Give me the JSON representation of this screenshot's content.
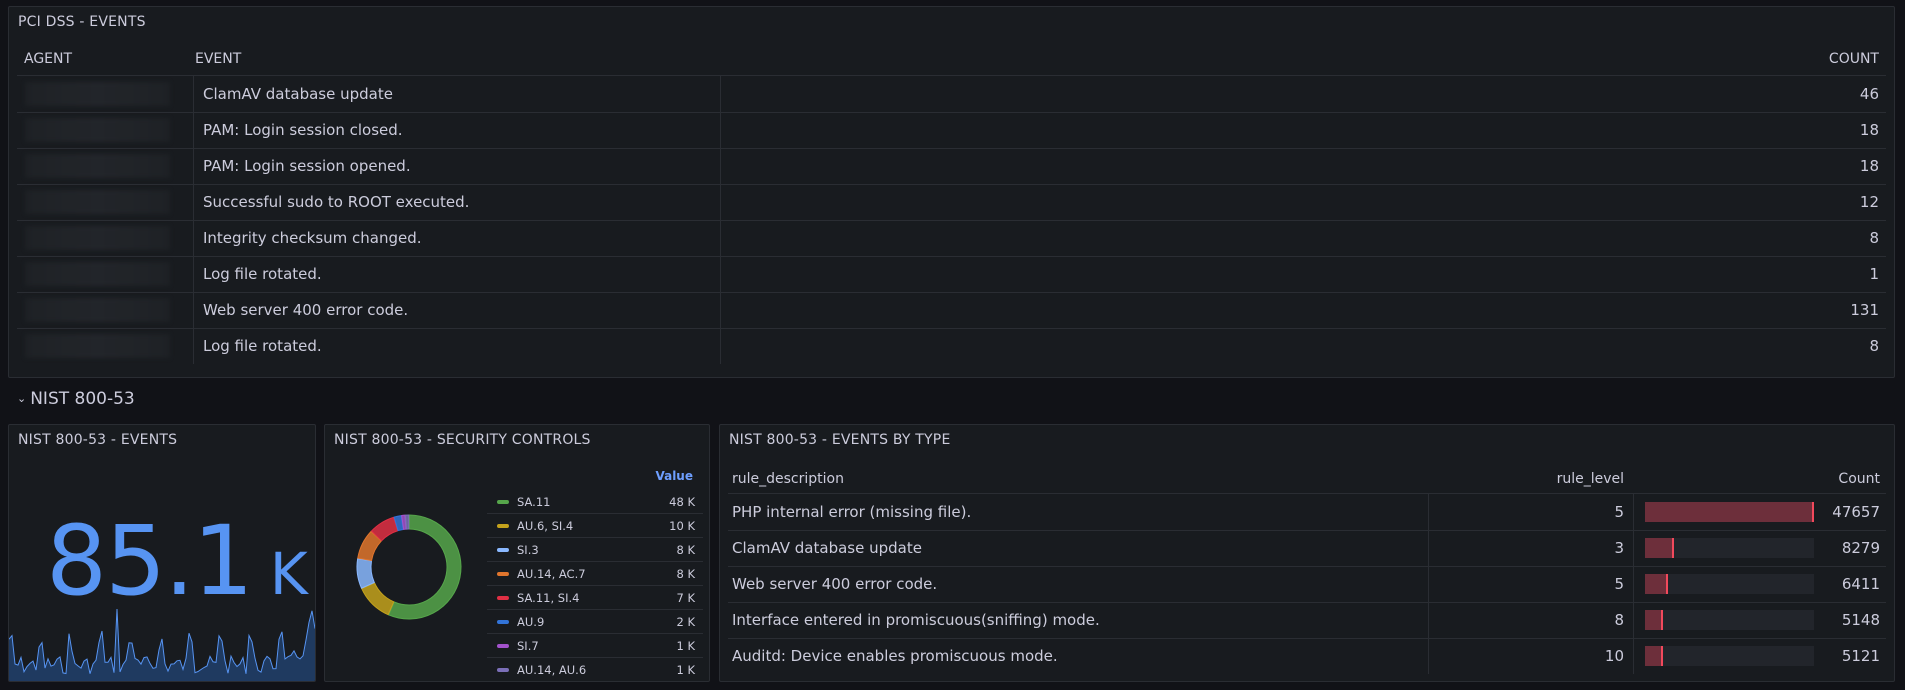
{
  "pci": {
    "title": "PCI DSS - EVENTS",
    "headers": {
      "agent": "AGENT",
      "event": "EVENT",
      "count": "COUNT"
    },
    "rows": [
      {
        "event": "ClamAV database update",
        "count": "46"
      },
      {
        "event": "PAM: Login session closed.",
        "count": "18"
      },
      {
        "event": "PAM: Login session opened.",
        "count": "18"
      },
      {
        "event": "Successful sudo to ROOT executed.",
        "count": "12"
      },
      {
        "event": "Integrity checksum changed.",
        "count": "8"
      },
      {
        "event": "Log file rotated.",
        "count": "1"
      },
      {
        "event": "Web server 400 error code.",
        "count": "131"
      },
      {
        "event": "Log file rotated.",
        "count": "8"
      }
    ]
  },
  "section": {
    "chevron": "⌄",
    "title": "NIST 800-53"
  },
  "stat": {
    "title": "NIST 800-53 - EVENTS",
    "value": "85.1",
    "unit": "K",
    "color": "#5794f2"
  },
  "controls": {
    "title": "NIST 800-53 - SECURITY CONTROLS",
    "legend_header": "Value",
    "items": [
      {
        "name": "SA.11",
        "value": "48 K",
        "num": 48,
        "color": "#56a64b"
      },
      {
        "name": "AU.6, SI.4",
        "value": "10 K",
        "num": 10,
        "color": "#c4a21c"
      },
      {
        "name": "SI.3",
        "value": "8 K",
        "num": 8,
        "color": "#8ab8ff"
      },
      {
        "name": "AU.14, AC.7",
        "value": "8 K",
        "num": 8,
        "color": "#e0752d"
      },
      {
        "name": "SA.11, SI.4",
        "value": "7 K",
        "num": 7,
        "color": "#e02f44"
      },
      {
        "name": "AU.9",
        "value": "2 K",
        "num": 2,
        "color": "#3274d9"
      },
      {
        "name": "SI.7",
        "value": "1 K",
        "num": 1,
        "color": "#a352cc"
      },
      {
        "name": "AU.14, AU.6",
        "value": "1 K",
        "num": 1,
        "color": "#7b6fb8"
      }
    ]
  },
  "bytype": {
    "title": "NIST 800-53 - EVENTS BY TYPE",
    "headers": {
      "desc": "rule_description",
      "level": "rule_level",
      "count": "Count"
    },
    "max": 47657,
    "rows": [
      {
        "desc": "PHP internal error (missing file).",
        "level": "5",
        "count": "47657",
        "num": 47657
      },
      {
        "desc": "ClamAV database update",
        "level": "3",
        "count": "8279",
        "num": 8279
      },
      {
        "desc": "Web server 400 error code.",
        "level": "5",
        "count": "6411",
        "num": 6411
      },
      {
        "desc": "Interface entered in promiscuous(sniffing) mode.",
        "level": "8",
        "count": "5148",
        "num": 5148
      },
      {
        "desc": "Auditd: Device enables promiscuous mode.",
        "level": "10",
        "count": "5121",
        "num": 5121
      }
    ]
  }
}
